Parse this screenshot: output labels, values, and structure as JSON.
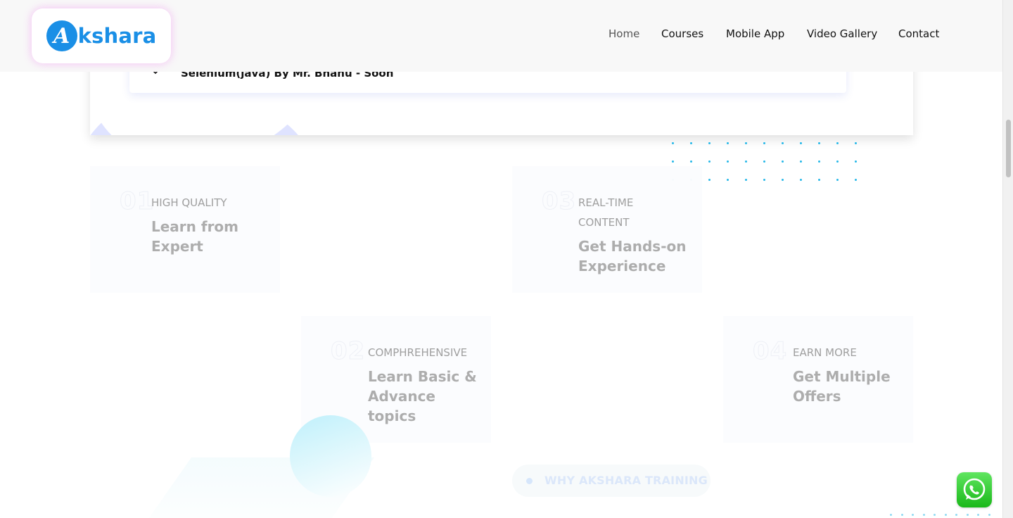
{
  "header": {
    "logo_letter": "A",
    "logo_text": "kshara",
    "nav": [
      {
        "label": "Home",
        "active": true
      },
      {
        "label": "Courses",
        "active": false
      },
      {
        "label": "Mobile App",
        "active": false
      },
      {
        "label": "Video Gallery",
        "active": false
      },
      {
        "label": "Contact",
        "active": false
      }
    ]
  },
  "course_panel": {
    "accordion_title": "Selenium(java) By Mr. Bhanu - Soon",
    "icon": "chevron-down-icon"
  },
  "features": [
    {
      "number": "01",
      "kicker": "HIGH QUALITY",
      "title": "Learn from Expert"
    },
    {
      "number": "02",
      "kicker": "COMPHREHENSIVE",
      "title": "Learn Basic & Advance topics"
    },
    {
      "number": "03",
      "kicker": "REAL-TIME CONTENT",
      "title": "Get Hands-on Experience"
    },
    {
      "number": "04",
      "kicker": "EARN MORE",
      "title": "Get Multiple Offers"
    }
  ],
  "why_section": {
    "label": "WHY AKSHARA TRAINING"
  },
  "floating": {
    "whatsapp_icon": "whatsapp-icon"
  },
  "colors": {
    "brand_blue": "#1a8fe6",
    "dot_cyan": "#27b8e8",
    "whatsapp_green": "#25d366"
  }
}
